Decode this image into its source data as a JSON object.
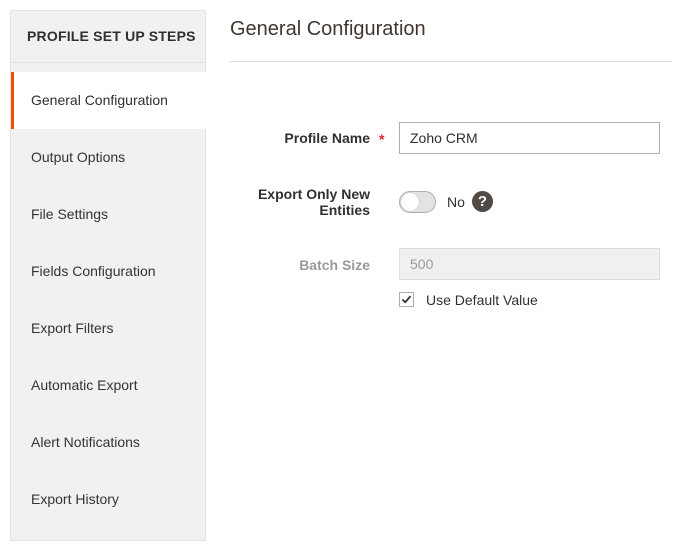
{
  "sidebar": {
    "title": "PROFILE SET UP STEPS",
    "items": [
      {
        "label": "General Configuration",
        "active": true
      },
      {
        "label": "Output Options"
      },
      {
        "label": "File Settings"
      },
      {
        "label": "Fields Configuration"
      },
      {
        "label": "Export Filters"
      },
      {
        "label": "Automatic Export"
      },
      {
        "label": "Alert Notifications"
      },
      {
        "label": "Export History"
      }
    ]
  },
  "main": {
    "title": "General Configuration",
    "profile_name": {
      "label": "Profile Name",
      "required_mark": "*",
      "value": "Zoho CRM"
    },
    "export_only_new": {
      "label_line1": "Export Only New",
      "label_line2": "Entities",
      "toggle_text": "No",
      "enabled": false,
      "help_icon": "question-circle-icon",
      "help_glyph": "?"
    },
    "batch_size": {
      "label": "Batch Size",
      "value": "500",
      "use_default_label": "Use Default Value",
      "use_default_checked": true
    }
  },
  "colors": {
    "accent": "#eb5202",
    "required": "#e22626",
    "help_icon_bg": "#514943"
  }
}
